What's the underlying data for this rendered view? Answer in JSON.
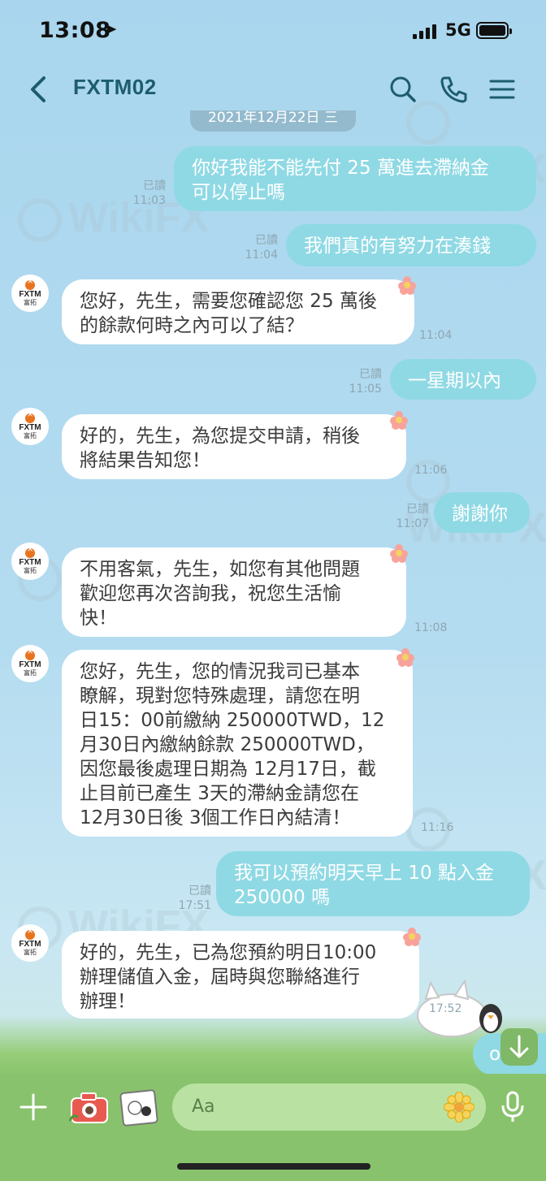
{
  "status_bar": {
    "time": "13:08",
    "network": "5G"
  },
  "header": {
    "title": "FXTM02"
  },
  "date_chip": "2021年12月22日 三",
  "avatar": {
    "brand": "FXTM",
    "subtitle": "富拓"
  },
  "messages": [
    {
      "dir": "out",
      "text": "你好我能不能先付 25 萬進去滯納金\n可以停止嗎",
      "read": "已讀",
      "time": "11:03"
    },
    {
      "dir": "out",
      "text": "我們真的有努力在湊錢",
      "read": "已讀",
      "time": "11:04"
    },
    {
      "dir": "in",
      "text": "您好，先生，需要您確認您 25 萬後\n的餘款何時之內可以了結？",
      "time": "11:04"
    },
    {
      "dir": "out",
      "text": "一星期以內",
      "read": "已讀",
      "time": "11:05"
    },
    {
      "dir": "in",
      "text": "好的，先生，為您提交申請，稍後\n將結果告知您！",
      "time": "11:06"
    },
    {
      "dir": "out",
      "text": "謝謝你",
      "read": "已讀",
      "time": "11:07"
    },
    {
      "dir": "in",
      "text": "不用客氣，先生，如您有其他問題\n歡迎您再次咨詢我，祝您生活愉\n快！",
      "time": "11:08"
    },
    {
      "dir": "in",
      "text": "您好，先生，您的情況我司已基本\n瞭解，現對您特殊處理，請您在明\n日15：00前繳納 250000TWD，12\n月30日內繳納餘款 250000TWD，\n因您最後處理日期為 12月17日，截\n止目前已產生 3天的滯納金請您在\n12月30日後 3個工作日內結清！",
      "time": "11:16"
    },
    {
      "dir": "out",
      "text": "我可以預約明天早上 10 點入金\n250000 嗎",
      "read": "已讀",
      "time": "17:51"
    },
    {
      "dir": "in",
      "text": "好的，先生，已為您預約明日10:00\n辦理儲值入金，屆時與您聯絡進行\n辦理！",
      "time": "17:52"
    }
  ],
  "partial_bubble": "o",
  "watermark": "WikiFX",
  "input": {
    "placeholder": "Aa"
  },
  "icons": [
    "back-arrow-icon",
    "search-icon",
    "phone-icon",
    "menu-icon",
    "plus-icon",
    "camera-icon",
    "sticker-icon",
    "emoji-flower-icon",
    "microphone-icon",
    "arrow-down-icon"
  ]
}
